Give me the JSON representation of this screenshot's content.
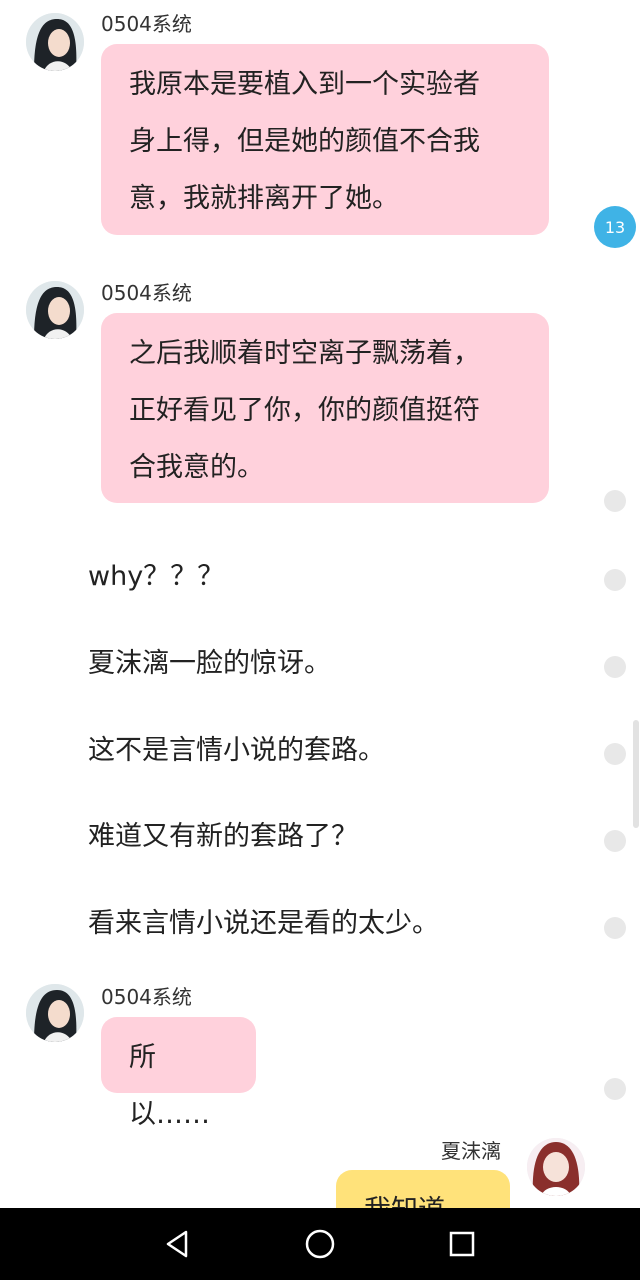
{
  "messages": [
    {
      "sender": "0504系统",
      "text": "我原本是要植入到一个实验者\n身上得，但是她的颜值不合我\n意，我就排离开了她。"
    },
    {
      "sender": "0504系统",
      "text": "之后我顺着时空离子飘荡着，\n正好看见了你，你的颜值挺符\n合我意的。"
    },
    {
      "sender": "0504系统",
      "text": "所以……"
    },
    {
      "sender": "夏沫漓",
      "text": "我知道"
    }
  ],
  "narration": [
    "why？？？",
    "夏沫漓一脸的惊讶。",
    "这不是言情小说的套路。",
    "难道又有新的套路了？",
    "看来言情小说还是看的太少。"
  ],
  "badge": {
    "count": "13"
  },
  "colors": {
    "bubble_pink": "#ffd1dc",
    "bubble_yellow": "#ffe27a",
    "badge_blue": "#3fb3e6",
    "navbar": "#000000"
  },
  "navbar": {
    "icons": [
      "back-triangle-icon",
      "home-circle-icon",
      "recents-square-icon"
    ]
  }
}
